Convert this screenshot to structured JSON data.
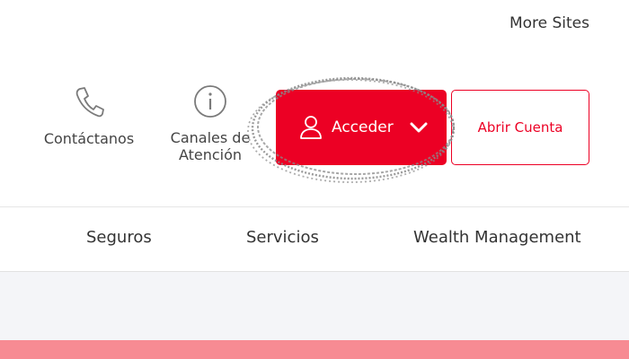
{
  "header": {
    "more_sites": "More Sites",
    "utility": [
      {
        "label": "Contáctanos",
        "icon": "phone-icon"
      },
      {
        "label": "Canales de Atención",
        "icon": "info-icon"
      }
    ],
    "login_button": {
      "label": "Acceder",
      "icon": "user-icon",
      "caret": "chevron-down-icon"
    },
    "open_account_button": {
      "label": "Abrir Cuenta"
    }
  },
  "nav": {
    "items": [
      {
        "label": "Seguros"
      },
      {
        "label": "Servicios"
      },
      {
        "label": "Wealth Management"
      }
    ]
  },
  "colors": {
    "brand_red": "#ec0024",
    "band_gray": "#f4f5f8",
    "band_pink": "#f78b93",
    "annotation": "#8a8a8a"
  }
}
